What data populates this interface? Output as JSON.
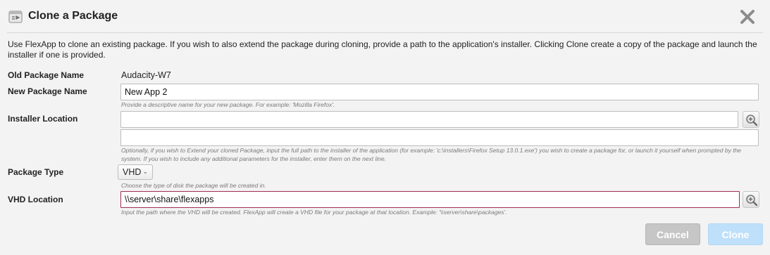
{
  "dialog": {
    "title": "Clone a Package",
    "icon": "package-clone-icon",
    "close_icon": "close-x-icon"
  },
  "intro": "Use FlexApp to clone an existing package. If you wish to also extend the package during cloning, provide a path to the application's installer. Clicking Clone create a copy of the package and launch the installer if one is provided.",
  "fields": {
    "old_name": {
      "label": "Old Package Name",
      "value": "Audacity-W7"
    },
    "new_name": {
      "label": "New Package Name",
      "value": "New App 2",
      "help": "Provide a descriptive name for your new package. For example: 'Mozilla Firefox'."
    },
    "installer": {
      "label": "Installer Location",
      "value": "",
      "params_value": "",
      "help": "Optionally, if you wish to Extend your cloned Package, input the full path to the installer of the application (for example: 'c:\\installers\\Firefox Setup 13.0.1.exe') you wish to create a package for, or launch it yourself when prompted by the system. If you wish to include any additional parameters for the installer, enter them on the next line."
    },
    "package_type": {
      "label": "Package Type",
      "selected": "VHD",
      "help": "Choose the type of disk the package will be created in."
    },
    "vhd_location": {
      "label": "VHD Location",
      "value": "\\\\server\\share\\flexapps",
      "help": "Input the path where the VHD will be created. FlexApp will create a VHD file for your package at that location. Example: '\\\\server\\share\\packages'."
    }
  },
  "buttons": {
    "cancel": "Cancel",
    "clone": "Clone"
  },
  "colors": {
    "background": "#f3f3f3",
    "focus_border": "#a0304f",
    "cancel_bg": "#c6c6c6",
    "clone_bg": "#bfe0fa"
  }
}
